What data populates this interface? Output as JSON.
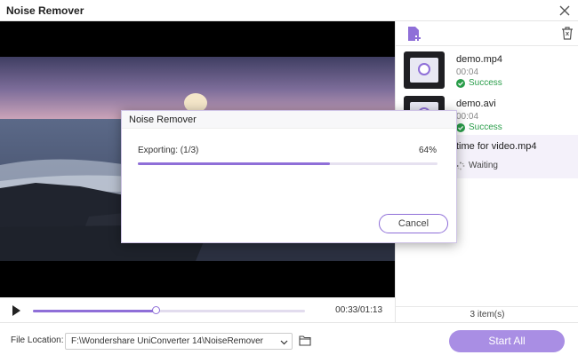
{
  "window": {
    "title": "Noise Remover"
  },
  "player": {
    "time": "00:33/01:13",
    "progress": 0.45
  },
  "file_list": {
    "items": [
      {
        "name": "demo.mp4",
        "duration": "00:04",
        "status": "Success",
        "status_type": "success"
      },
      {
        "name": "demo.avi",
        "duration": "00:04",
        "status": "Success",
        "status_type": "success"
      },
      {
        "name": "time for video.mp4",
        "duration": "",
        "status": "Waiting",
        "status_type": "waiting"
      }
    ],
    "count": "3 item(s)"
  },
  "bottom": {
    "file_location_label": "File Location:",
    "path": "F:\\Wondershare UniConverter 14\\NoiseRemover",
    "start_all": "Start All"
  },
  "dialog": {
    "title": "Noise Remover",
    "exporting": "Exporting: (1/3)",
    "percent": "64%",
    "progress": 0.64,
    "cancel": "Cancel"
  },
  "colors": {
    "accent": "#8f6fd8",
    "success": "#2a9d4a",
    "start_button": "#a98ee4"
  },
  "icons": {
    "close": "close-icon",
    "add": "add-file-icon",
    "trash": "trash-icon",
    "play": "play-icon",
    "folder": "folder-icon",
    "dropdown": "chevron-down-icon",
    "success": "check-circle-icon",
    "waiting": "spinner-icon"
  }
}
